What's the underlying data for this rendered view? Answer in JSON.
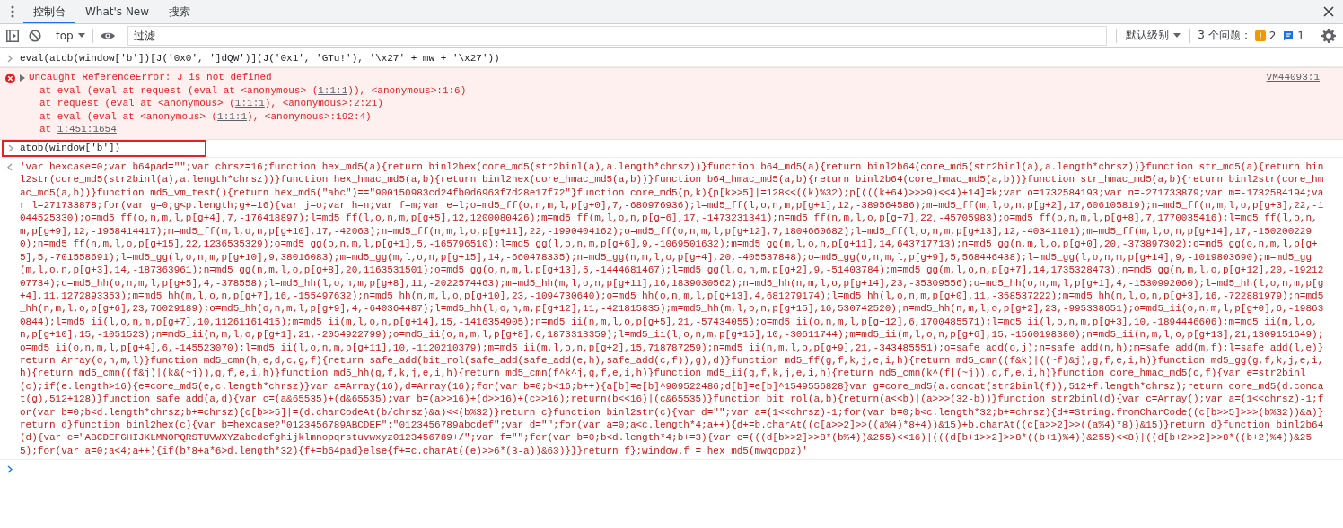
{
  "tabs": [
    {
      "label": "控制台",
      "selected": true
    },
    {
      "label": "What's New",
      "selected": false
    },
    {
      "label": "搜索",
      "selected": false
    }
  ],
  "toolbar": {
    "context": "top",
    "filter": {
      "placeholder": "过滤"
    },
    "level": "默认级别",
    "issues": {
      "label": "3 个问题：",
      "warnings": "2",
      "infos": "1"
    }
  },
  "console": [
    {
      "kind": "input",
      "text": "eval(atob(window['b'])[J('0x0', ']dQW')](J('0x1', 'GTu!'), '\\x27' + mw + '\\x27'))",
      "highlighted": false
    },
    {
      "kind": "error",
      "message": "Uncaught ReferenceError: J is not defined",
      "source": "VM44093:1",
      "stack": [
        {
          "before": "at eval (eval at request (eval at <anonymous> (",
          "link": "1:1:1",
          "after": ")), <anonymous>:1:6)"
        },
        {
          "before": "at request (eval at <anonymous> (",
          "link": "1:1:1",
          "after": "), <anonymous>:2:21)"
        },
        {
          "before": "at eval (eval at <anonymous> (",
          "link": "1:1:1",
          "after": "), <anonymous>:192:4)"
        },
        {
          "before": "at ",
          "link": "1:451:1654"
        }
      ]
    },
    {
      "kind": "input",
      "text": "atob(window['b'])",
      "highlighted": true
    },
    {
      "kind": "result",
      "text": "'var hexcase=0;var b64pad=\"\";var chrsz=16;function hex_md5(a){return binl2hex(core_md5(str2binl(a),a.length*chrsz))}function b64_md5(a){return binl2b64(core_md5(str2binl(a),a.length*chrsz))}function str_md5(a){return bin\nl2str(core_md5(str2binl(a),a.length*chrsz))}function hex_hmac_md5(a,b){return binl2hex(core_hmac_md5(a,b))}function b64_hmac_md5(a,b){return binl2b64(core_hmac_md5(a,b))}function str_hmac_md5(a,b){return binl2str(core_hm\nac_md5(a,b))}function md5_vm_test(){return hex_md5(\"abc\")==\"900150983cd24fb0d6963f7d28e17f72\"}function core_md5(p,k){p[k>>5]|=128<<((k)%32);p[(((k+64)>>>9)<<4)+14]=k;var o=1732584193;var n=-271733879;var m=-1732584194;va\nr l=271733878;for(var g=0;g<p.length;g+=16){var j=o;var h=n;var f=m;var e=l;o=md5_ff(o,n,m,l,p[g+0],7,-680976936);l=md5_ff(l,o,n,m,p[g+1],12,-389564586);m=md5_ff(m,l,o,n,p[g+2],17,606105819);n=md5_ff(n,m,l,o,p[g+3],22,-1\n044525330);o=md5_ff(o,n,m,l,p[g+4],7,-176418897);l=md5_ff(l,o,n,m,p[g+5],12,1200080426);m=md5_ff(m,l,o,n,p[g+6],17,-1473231341);n=md5_ff(n,m,l,o,p[g+7],22,-45705983);o=md5_ff(o,n,m,l,p[g+8],7,1770035416);l=md5_ff(l,o,n,\nm,p[g+9],12,-1958414417);m=md5_ff(m,l,o,n,p[g+10],17,-42063);n=md5_ff(n,m,l,o,p[g+11],22,-1990404162);o=md5_ff(o,n,m,l,p[g+12],7,1804660682);l=md5_ff(l,o,n,m,p[g+13],12,-40341101);m=md5_ff(m,l,o,n,p[g+14],17,-150200229\n0);n=md5_ff(n,m,l,o,p[g+15],22,1236535329);o=md5_gg(o,n,m,l,p[g+1],5,-165796510);l=md5_gg(l,o,n,m,p[g+6],9,-1069501632);m=md5_gg(m,l,o,n,p[g+11],14,643717713);n=md5_gg(n,m,l,o,p[g+0],20,-373897302);o=md5_gg(o,n,m,l,p[g+\n5],5,-701558691);l=md5_gg(l,o,n,m,p[g+10],9,38016083);m=md5_gg(m,l,o,n,p[g+15],14,-660478335);n=md5_gg(n,m,l,o,p[g+4],20,-405537848);o=md5_gg(o,n,m,l,p[g+9],5,568446438);l=md5_gg(l,o,n,m,p[g+14],9,-1019803690);m=md5_gg\n(m,l,o,n,p[g+3],14,-187363961);n=md5_gg(n,m,l,o,p[g+8],20,1163531501);o=md5_gg(o,n,m,l,p[g+13],5,-1444681467);l=md5_gg(l,o,n,m,p[g+2],9,-51403784);m=md5_gg(m,l,o,n,p[g+7],14,1735328473);n=md5_gg(n,m,l,o,p[g+12],20,-19212\n07734);o=md5_hh(o,n,m,l,p[g+5],4,-378558);l=md5_hh(l,o,n,m,p[g+8],11,-2022574463);m=md5_hh(m,l,o,n,p[g+11],16,1839030562);n=md5_hh(n,m,l,o,p[g+14],23,-35309556);o=md5_hh(o,n,m,l,p[g+1],4,-1530992060);l=md5_hh(l,o,n,m,p[g\n+4],11,1272893353);m=md5_hh(m,l,o,n,p[g+7],16,-155497632);n=md5_hh(n,m,l,o,p[g+10],23,-1094730640);o=md5_hh(o,n,m,l,p[g+13],4,681279174);l=md5_hh(l,o,n,m,p[g+0],11,-358537222);m=md5_hh(m,l,o,n,p[g+3],16,-722881979);n=md5\n_hh(n,m,l,o,p[g+6],23,76029189);o=md5_hh(o,n,m,l,p[g+9],4,-640364487);l=md5_hh(l,o,n,m,p[g+12],11,-421815835);m=md5_hh(m,l,o,n,p[g+15],16,530742520);n=md5_hh(n,m,l,o,p[g+2],23,-995338651);o=md5_ii(o,n,m,l,p[g+0],6,-19863\n0844);l=md5_ii(l,o,n,m,p[g+7],10,11261161415);m=md5_ii(m,l,o,n,p[g+14],15,-1416354905);n=md5_ii(n,m,l,o,p[g+5],21,-57434055);o=md5_ii(o,n,m,l,p[g+12],6,1700485571);l=md5_ii(l,o,n,m,p[g+3],10,-1894446606);m=md5_ii(m,l,o,\nn,p[g+10],15,-1051523);n=md5_ii(n,m,l,o,p[g+1],21,-2054922799);o=md5_ii(o,n,m,l,p[g+8],6,1873313359);l=md5_ii(l,o,n,m,p[g+15],10,-30611744);m=md5_ii(m,l,o,n,p[g+6],15,-1560198380);n=md5_ii(n,m,l,o,p[g+13],21,1309151649);\no=md5_ii(o,n,m,l,p[g+4],6,-145523070);l=md5_ii(l,o,n,m,p[g+11],10,-1120210379);m=md5_ii(m,l,o,n,p[g+2],15,718787259);n=md5_ii(n,m,l,o,p[g+9],21,-343485551);o=safe_add(o,j);n=safe_add(n,h);m=safe_add(m,f);l=safe_add(l,e)}\nreturn Array(o,n,m,l)}function md5_cmn(h,e,d,c,g,f){return safe_add(bit_rol(safe_add(safe_add(e,h),safe_add(c,f)),g),d)}function md5_ff(g,f,k,j,e,i,h){return md5_cmn((f&k)|((~f)&j),g,f,e,i,h)}function md5_gg(g,f,k,j,e,i,\nh){return md5_cmn((f&j)|(k&(~j)),g,f,e,i,h)}function md5_hh(g,f,k,j,e,i,h){return md5_cmn(f^k^j,g,f,e,i,h)}function md5_ii(g,f,k,j,e,i,h){return md5_cmn(k^(f|(~j)),g,f,e,i,h)}function core_hmac_md5(c,f){var e=str2binl\n(c);if(e.length>16){e=core_md5(e,c.length*chrsz)}var a=Array(16),d=Array(16);for(var b=0;b<16;b++){a[b]=e[b]^909522486;d[b]=e[b]^1549556828}var g=core_md5(a.concat(str2binl(f)),512+f.length*chrsz);return core_md5(d.conca\nt(g),512+128)}function safe_add(a,d){var c=(a&65535)+(d&65535);var b=(a>>16)+(d>>16)+(c>>16);return(b<<16)|(c&65535)}function bit_rol(a,b){return(a<<b)|(a>>>(32-b))}function str2binl(d){var c=Array();var a=(1<<chrsz)-1;f\nor(var b=0;b<d.length*chrsz;b+=chrsz){c[b>>5]|=(d.charCodeAt(b/chrsz)&a)<<(b%32)}return c}function binl2str(c){var d=\"\";var a=(1<<chrsz)-1;for(var b=0;b<c.length*32;b+=chrsz){d+=String.fromCharCode((c[b>>5]>>>(b%32))&a)}\nreturn d}function binl2hex(c){var b=hexcase?\"0123456789ABCDEF\":\"0123456789abcdef\";var d=\"\";for(var a=0;a<c.length*4;a++){d+=b.charAt((c[a>>2]>>((a%4)*8+4))&15)+b.charAt((c[a>>2]>>((a%4)*8))&15)}return d}function binl2b64\n(d){var c=\"ABCDEFGHIJKLMNOPQRSTUVWXYZabcdefghijklmnopqrstuvwxyz0123456789+/\";var f=\"\";for(var b=0;b<d.length*4;b+=3){var e=(((d[b>>2]>>8*(b%4))&255)<<16)|(((d[b+1>>2]>>8*((b+1)%4))&255)<<8)|((d[b+2>>2]>>8*((b+2)%4))&25\n5);for(var a=0;a<4;a++){if(b*8+a*6>d.length*32){f+=b64pad}else{f+=c.charAt((e)>>6*(3-a))&63)}}}return f};window.f = hex_md5(mwqqppz)'"
    },
    {
      "kind": "prompt"
    }
  ]
}
